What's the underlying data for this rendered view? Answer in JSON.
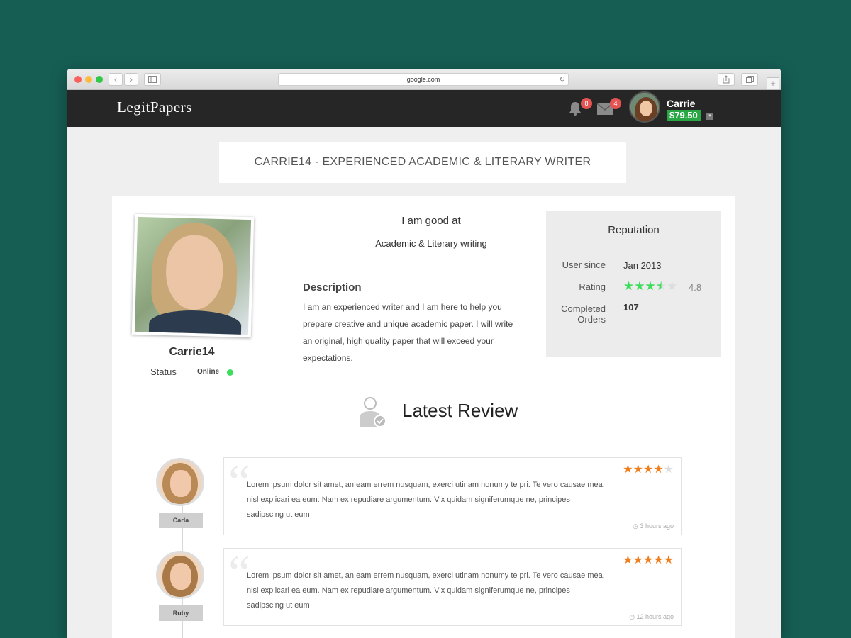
{
  "browser": {
    "url": "google.com",
    "nav_back": "‹",
    "nav_forward": "›",
    "reload": "↻",
    "new_tab": "+"
  },
  "header": {
    "logo": "LegitPapers",
    "notifications_count": "8",
    "messages_count": "4",
    "user_name": "Carrie",
    "balance": "$79.50",
    "caret": "▾"
  },
  "page_title": "CARRIE14 - EXPERIENCED ACADEMIC & LITERARY WRITER",
  "profile": {
    "name": "Carrie14",
    "status_label": "Status",
    "status_value": "Online",
    "status_color": "#3ddc5a"
  },
  "skills": {
    "heading": "I am good at",
    "value": "Academic & Literary writing"
  },
  "description": {
    "heading": "Description",
    "text": "I am an experienced writer and I am here to help you prepare creative and unique academic paper. I will write an original, high quality paper that will exceed your expectations."
  },
  "reputation": {
    "title": "Reputation",
    "user_since_label": "User since",
    "user_since_value": "Jan 2013",
    "rating_label": "Rating",
    "rating_value": "4.8",
    "rating_stars": 3.5,
    "completed_label_1": "Completed",
    "completed_label_2": "Orders",
    "completed_value": "107"
  },
  "latest_review": {
    "title": "Latest Review",
    "reviews": [
      {
        "reviewer": "Carla",
        "stars": 4,
        "text": "Lorem ipsum dolor sit amet, an eam errem nusquam, exerci utinam nonumy te pri. Te vero causae mea, nisl explicari ea eum. Nam ex repudiare argumentum. Vix quidam signiferumque ne, principes sadipscing ut eum",
        "time": "3 hours ago"
      },
      {
        "reviewer": "Ruby",
        "stars": 5,
        "text": "Lorem ipsum dolor sit amet, an eam errem nusquam, exerci utinam nonumy te pri. Te vero causae mea, nisl explicari ea eum. Nam ex repudiare argumentum. Vix quidam signiferumque ne, principes sadipscing ut eum",
        "time": "12 hours ago"
      }
    ]
  },
  "colors": {
    "background": "#165e54",
    "header": "#262626",
    "balance": "#29a745",
    "badge": "#e55353",
    "review_star": "#f07c1b",
    "rating_star": "#3ddc5a"
  }
}
